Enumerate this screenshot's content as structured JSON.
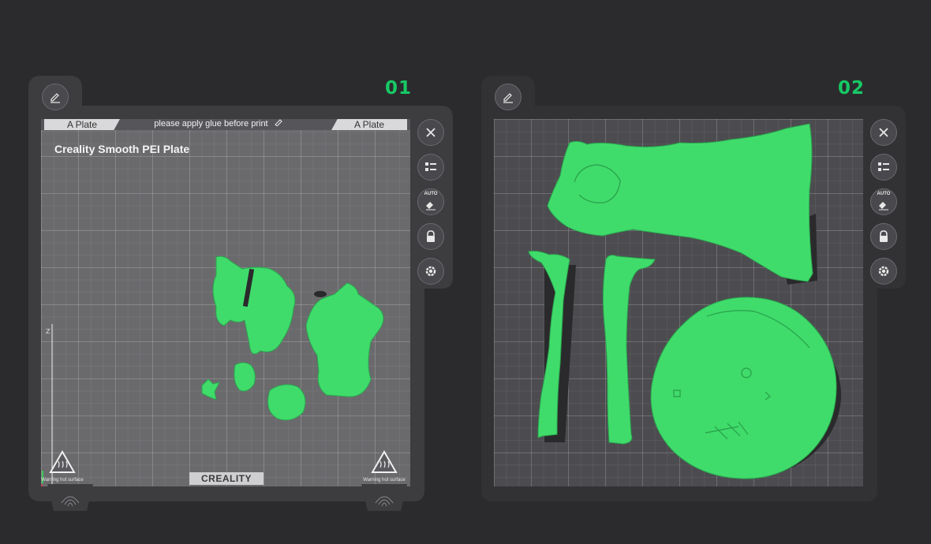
{
  "plates": [
    {
      "number": "01",
      "tab_left": "A Plate",
      "tab_right": "A Plate",
      "note": "please apply glue before print",
      "plate_type": "Creality Smooth PEI Plate",
      "brand": "CREALITY",
      "warning_left": "Warning hot surface",
      "warning_right": "Warning hot surface",
      "tools": [
        "close-icon",
        "list-icon",
        "auto-arrange-icon",
        "lock-icon",
        "settings-icon"
      ],
      "auto_label": "AUTO"
    },
    {
      "number": "02",
      "tools": [
        "close-icon",
        "list-icon",
        "auto-arrange-icon",
        "lock-icon",
        "settings-icon"
      ],
      "auto_label": "AUTO"
    }
  ],
  "colors": {
    "background": "#2b2b2e",
    "panel": "#3d3d40",
    "accent_green": "#17c964",
    "model_green": "#3ddb6a"
  }
}
